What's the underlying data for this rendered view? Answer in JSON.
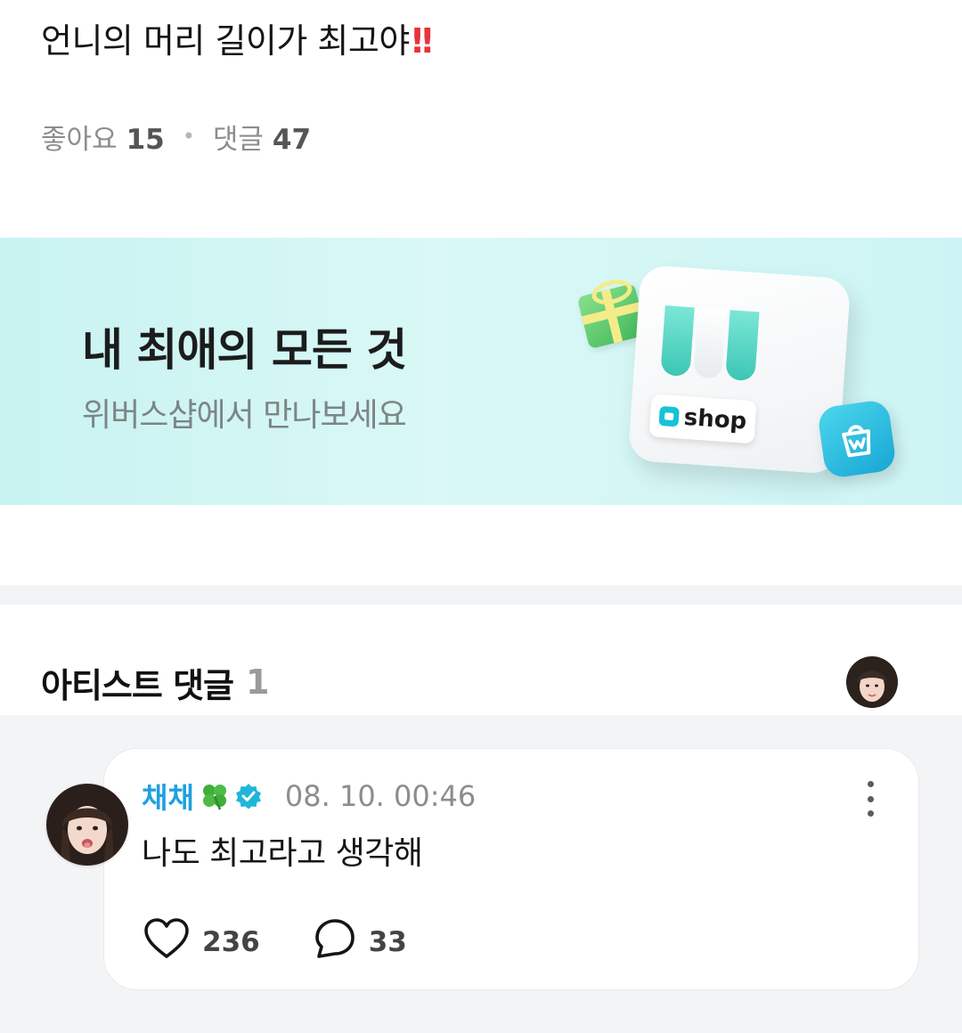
{
  "post": {
    "text": "언니의 머리 길이가 최고야",
    "emoji": "!!",
    "likes_label": "좋아요",
    "likes_count": "15",
    "comments_label": "댓글",
    "comments_count": "47"
  },
  "banner": {
    "title": "내 최애의 모든 것",
    "subtitle": "위버스샵에서 만나보세요",
    "sign_text": "shop"
  },
  "artist_comments": {
    "title": "아티스트 댓글",
    "count": "1",
    "comments": [
      {
        "author": "채채",
        "time": "08. 10. 00:46",
        "body": "나도 최고라고 생각해",
        "likes": "236",
        "replies": "33"
      }
    ]
  },
  "colors": {
    "author": "#1ea0e0",
    "verified": "#1fb6d9",
    "banner_bg": "#c8f3f1",
    "emoji": "#e8323c"
  },
  "icons": [
    "clover-icon",
    "verified-badge-icon",
    "more-icon",
    "heart-icon",
    "comment-bubble-icon",
    "shopping-bag-icon",
    "gift-icon"
  ]
}
